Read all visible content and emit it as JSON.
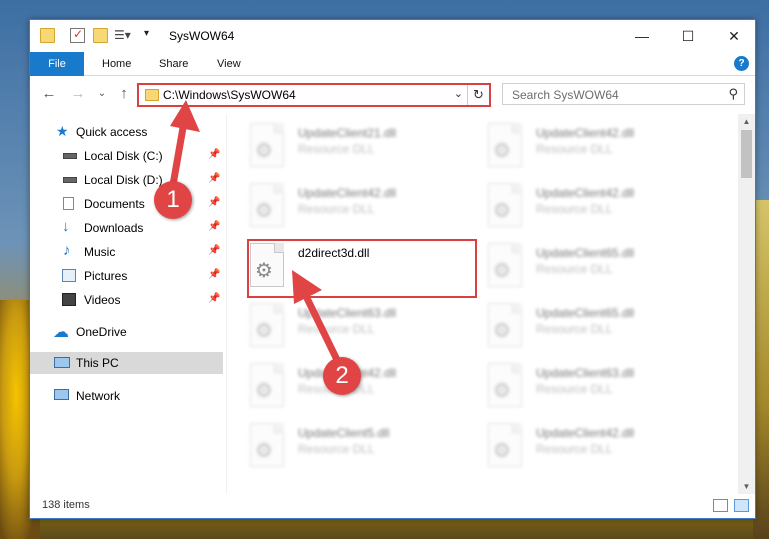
{
  "window": {
    "title": "SysWOW64"
  },
  "window_controls": {
    "minimize": "—",
    "maximize": "☐",
    "close": "✕"
  },
  "ribbon": {
    "tabs": [
      "File",
      "Home",
      "Share",
      "View"
    ],
    "help": "?"
  },
  "address_bar": {
    "path": "C:\\Windows\\SysWOW64"
  },
  "search": {
    "placeholder": "Search SysWOW64"
  },
  "sidebar": {
    "items": [
      {
        "label": "Quick access",
        "icon": "star-icon",
        "pinned": false
      },
      {
        "label": "Local Disk (C:)",
        "icon": "drive-icon",
        "pinned": true
      },
      {
        "label": "Local Disk (D:)",
        "icon": "drive-icon",
        "pinned": true
      },
      {
        "label": "Documents",
        "icon": "documents-icon",
        "pinned": true
      },
      {
        "label": "Downloads",
        "icon": "download-icon",
        "pinned": true
      },
      {
        "label": "Music",
        "icon": "music-icon",
        "pinned": true
      },
      {
        "label": "Pictures",
        "icon": "pictures-icon",
        "pinned": true
      },
      {
        "label": "Videos",
        "icon": "videos-icon",
        "pinned": true
      },
      {
        "label": "OneDrive",
        "icon": "cloud-icon",
        "pinned": false
      },
      {
        "label": "This PC",
        "icon": "computer-icon",
        "pinned": false,
        "selected": true
      },
      {
        "label": "Network",
        "icon": "network-icon",
        "pinned": false
      }
    ]
  },
  "files": [
    {
      "name": "UpdateClient21.dll",
      "type": "Resource DLL",
      "blurred": true
    },
    {
      "name": "UpdateClient42.dll",
      "type": "Resource DLL",
      "blurred": true
    },
    {
      "name": "UpdateClient42.dll",
      "type": "Resource DLL",
      "blurred": true
    },
    {
      "name": "UpdateClient42.dll",
      "type": "Resource DLL",
      "blurred": true
    },
    {
      "name": "d2direct3d.dll",
      "type": "",
      "blurred": false,
      "highlighted": true
    },
    {
      "name": "UpdateClient65.dll",
      "type": "Resource DLL",
      "blurred": true
    },
    {
      "name": "UpdateClient63.dll",
      "type": "Resource DLL",
      "blurred": true
    },
    {
      "name": "UpdateClient65.dll",
      "type": "Resource DLL",
      "blurred": true
    },
    {
      "name": "UpdateClient42.dll",
      "type": "Resource DLL",
      "blurred": true
    },
    {
      "name": "UpdateClient63.dll",
      "type": "Resource DLL",
      "blurred": true
    },
    {
      "name": "UpdateClient5.dll",
      "type": "Resource DLL",
      "blurred": true
    },
    {
      "name": "UpdateClient42.dll",
      "type": "Resource DLL",
      "blurred": true
    }
  ],
  "status": {
    "item_count": "138 items"
  },
  "annotations": {
    "step1": "1",
    "step2": "2",
    "color": "#e04444"
  }
}
